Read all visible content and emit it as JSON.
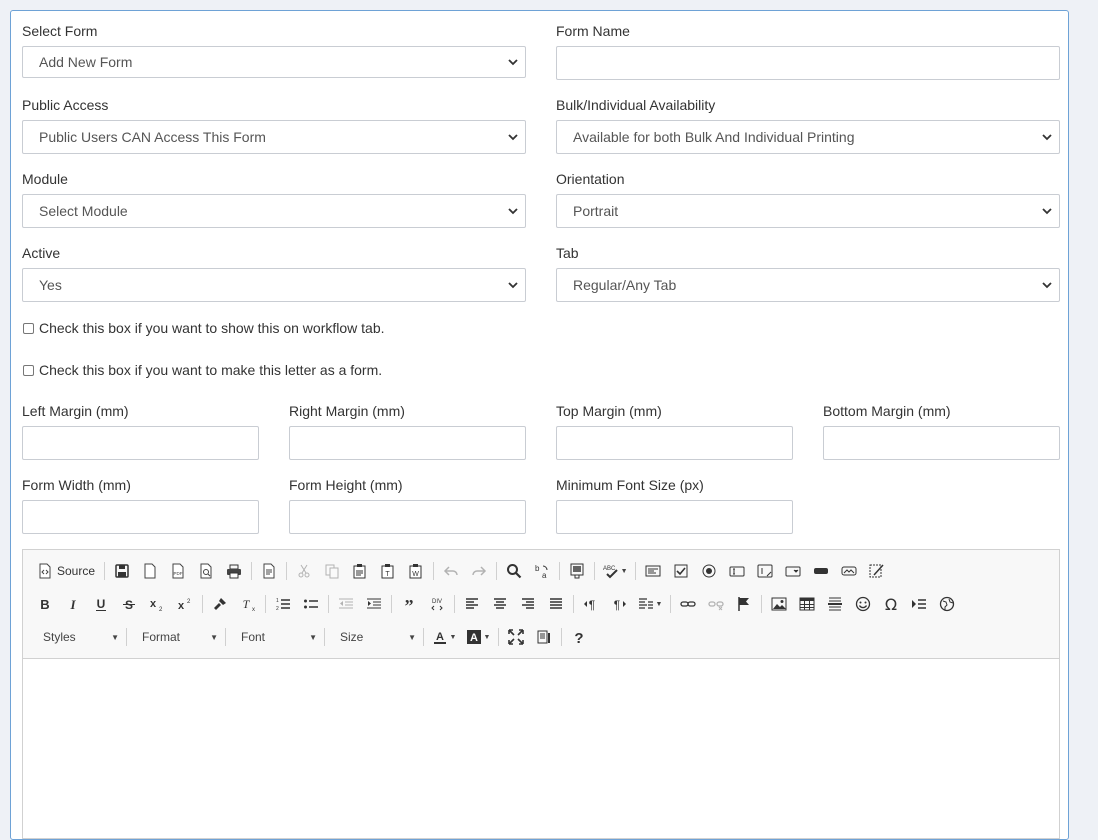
{
  "form": {
    "select_form": {
      "label": "Select Form",
      "value": "Add New Form"
    },
    "form_name": {
      "label": "Form Name",
      "value": ""
    },
    "public_access": {
      "label": "Public Access",
      "value": "Public Users CAN Access This Form"
    },
    "availability": {
      "label": "Bulk/Individual Availability",
      "value": "Available for both Bulk And Individual Printing"
    },
    "module": {
      "label": "Module",
      "value": "Select Module"
    },
    "orientation": {
      "label": "Orientation",
      "value": "Portrait"
    },
    "active": {
      "label": "Active",
      "value": "Yes"
    },
    "tab": {
      "label": "Tab",
      "value": "Regular/Any Tab"
    },
    "workflow_checkbox": {
      "label": "Check this box if you want to show this on workflow tab.",
      "checked": false
    },
    "letter_form_checkbox": {
      "label": "Check this box if you want to make this letter as a form.",
      "checked": false
    },
    "left_margin": {
      "label": "Left Margin (mm)",
      "value": ""
    },
    "right_margin": {
      "label": "Right Margin (mm)",
      "value": ""
    },
    "top_margin": {
      "label": "Top Margin (mm)",
      "value": ""
    },
    "bottom_margin": {
      "label": "Bottom Margin (mm)",
      "value": ""
    },
    "form_width": {
      "label": "Form Width (mm)",
      "value": ""
    },
    "form_height": {
      "label": "Form Height (mm)",
      "value": ""
    },
    "min_font_size": {
      "label": "Minimum Font Size (px)",
      "value": ""
    }
  },
  "editor": {
    "source_label": "Source",
    "styles_label": "Styles",
    "format_label": "Format",
    "font_label": "Font",
    "size_label": "Size",
    "content": ""
  },
  "colors": {
    "panel_border": "#6ea2d6",
    "page_background": "#eef1f6",
    "toolbar_background": "#f8f8f8"
  }
}
